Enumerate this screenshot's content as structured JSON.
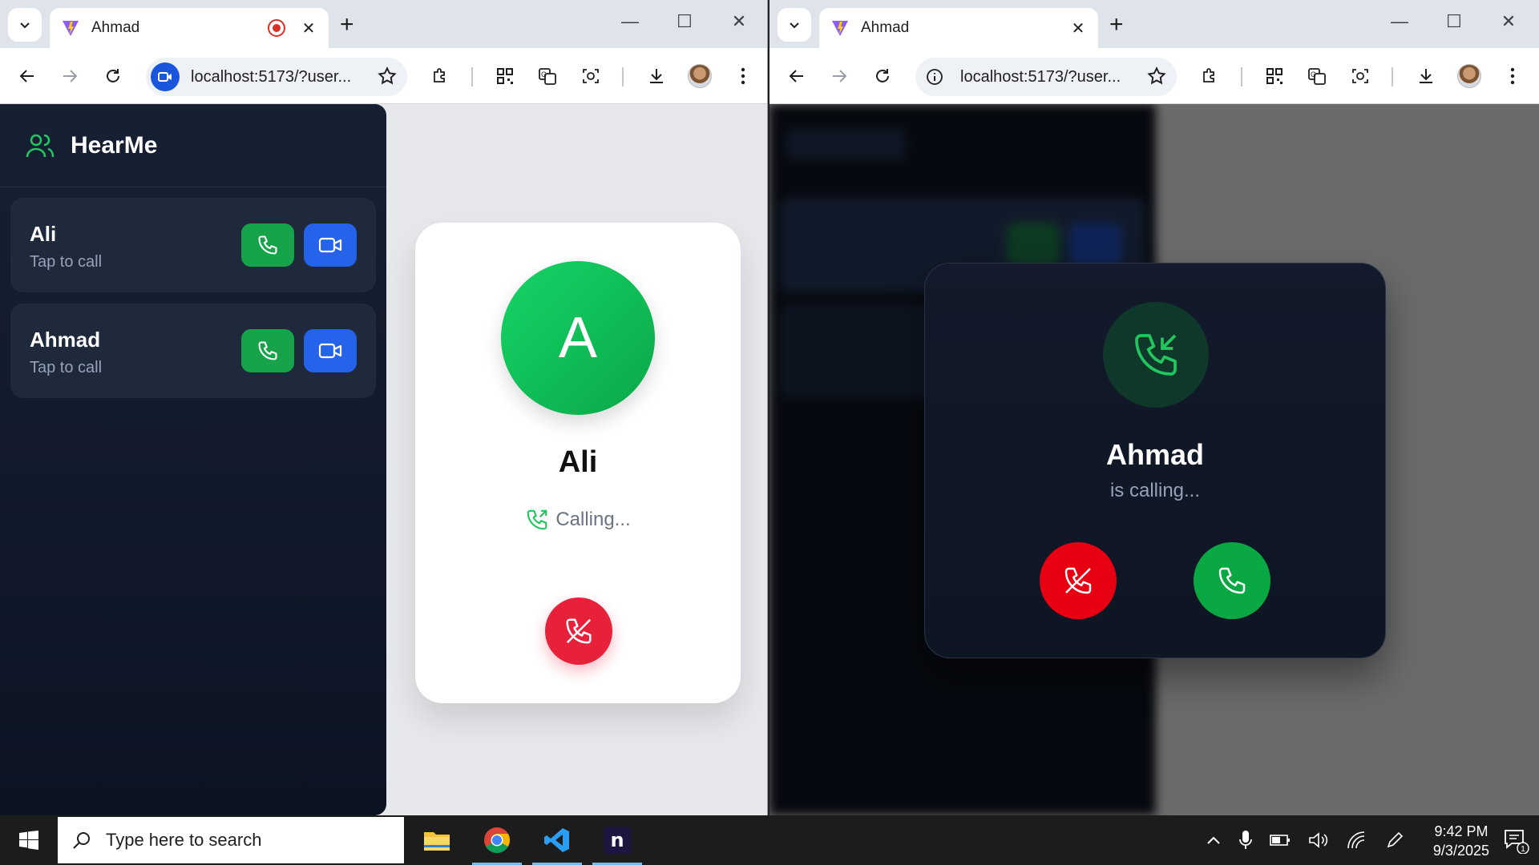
{
  "left_window": {
    "tab_title": "Ahmad",
    "url": "localhost:5173/?user...",
    "app": {
      "brand": "HearMe",
      "contacts": [
        {
          "name": "Ali",
          "subtitle": "Tap to call"
        },
        {
          "name": "Ahmad",
          "subtitle": "Tap to call"
        }
      ],
      "call_card": {
        "avatar_letter": "A",
        "name": "Ali",
        "status": "Calling..."
      }
    }
  },
  "right_window": {
    "tab_title": "Ahmad",
    "url": "localhost:5173/?user...",
    "incoming_call": {
      "caller": "Ahmad",
      "subtitle": "is calling..."
    }
  },
  "taskbar": {
    "search_placeholder": "Type here to search",
    "time": "9:42 PM",
    "date": "9/3/2025",
    "notification_count": "1"
  },
  "colors": {
    "brand_green": "#22c55e",
    "call_green": "#16a34a",
    "video_blue": "#2563eb",
    "end_red": "#e8213a",
    "sidebar_bg": "#0f172a"
  }
}
